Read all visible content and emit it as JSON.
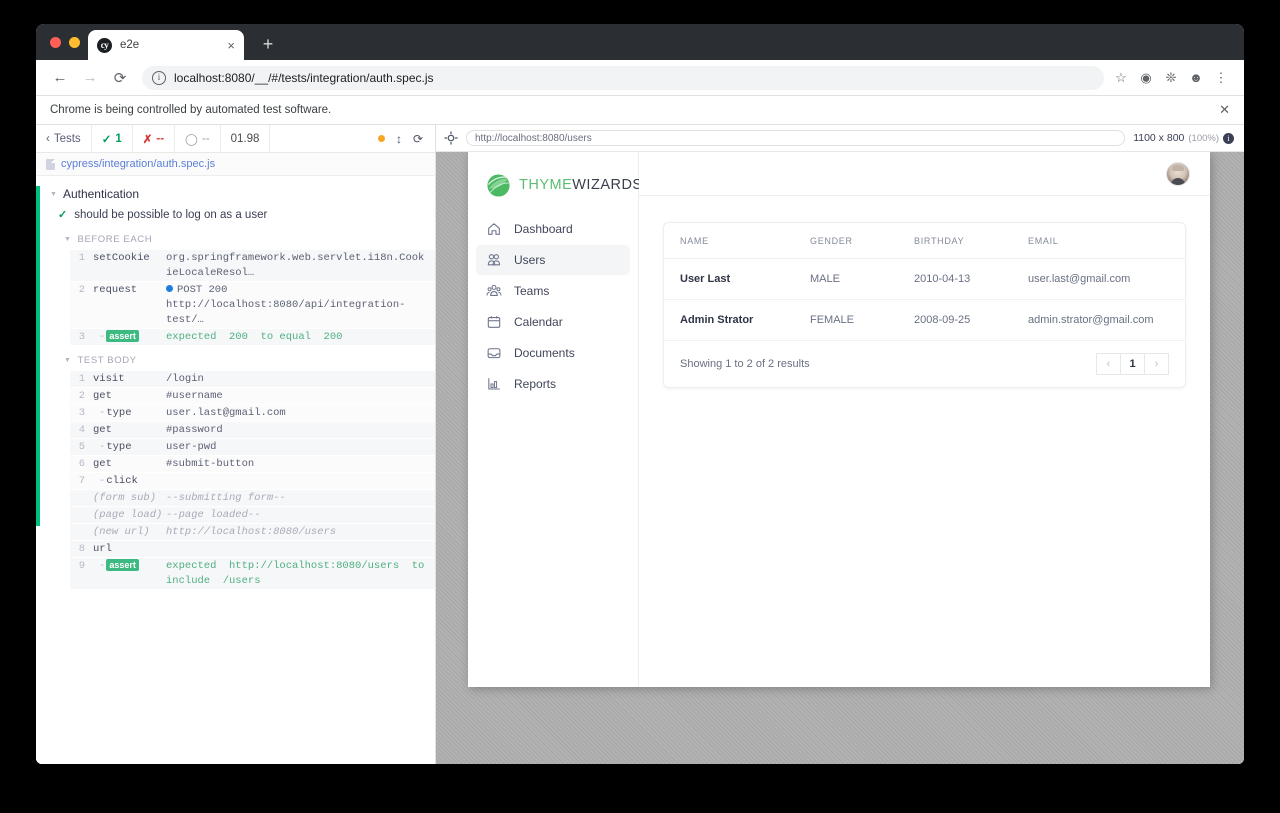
{
  "browser": {
    "tab": {
      "title": "e2e",
      "favicon": "cypress-logo-icon",
      "close_label": "×"
    },
    "new_tab_label": "+",
    "nav": {
      "back": "←",
      "forward": "→",
      "reload": "⟳"
    },
    "address": {
      "url": "localhost:8080/__/#/tests/integration/auth.spec.js",
      "info_icon": "i"
    },
    "toolbar_icons": [
      "bookmark-star-icon",
      "extension-cypress-icon",
      "extensions-puzzle-icon",
      "profile-icon",
      "chrome-menu-icon"
    ],
    "infobar": {
      "message": "Chrome is being controlled by automated test software.",
      "close": "✕"
    }
  },
  "runner": {
    "header": {
      "back_label": "Tests",
      "passed": "1",
      "failed": "--",
      "pending": "--",
      "duration": "01.98",
      "icons": [
        "record-dot-icon",
        "resize-handle-icon",
        "restart-icon",
        "selector-playground-icon"
      ]
    },
    "spec_path": "cypress/integration/auth.spec.js",
    "suite": "Authentication",
    "test": "should be possible to log on as a user",
    "hooks": [
      {
        "label": "BEFORE EACH",
        "commands": [
          {
            "num": "1",
            "name": "setCookie",
            "message": "org.springframework.web.servlet.i18n.CookieLocaleResol…",
            "type": "normal"
          },
          {
            "num": "2",
            "name": "request",
            "message": "POST 200 http://localhost:8080/api/integration-test/…",
            "type": "request"
          },
          {
            "num": "3",
            "name": "assert",
            "message": "expected  200  to equal  200",
            "type": "assert"
          }
        ]
      },
      {
        "label": "TEST BODY",
        "commands": [
          {
            "num": "1",
            "name": "visit",
            "message": "/login",
            "type": "normal"
          },
          {
            "num": "2",
            "name": "get",
            "message": "#username",
            "type": "normal"
          },
          {
            "num": "3",
            "name": "type",
            "message": "user.last@gmail.com",
            "type": "child"
          },
          {
            "num": "4",
            "name": "get",
            "message": "#password",
            "type": "normal"
          },
          {
            "num": "5",
            "name": "type",
            "message": "user-pwd",
            "type": "child"
          },
          {
            "num": "6",
            "name": "get",
            "message": "#submit-button",
            "type": "normal"
          },
          {
            "num": "7",
            "name": "click",
            "message": "",
            "type": "child"
          },
          {
            "num": "",
            "name": "(form sub)",
            "message": "--submitting form--",
            "type": "event"
          },
          {
            "num": "",
            "name": "(page load)",
            "message": "--page loaded--",
            "type": "event"
          },
          {
            "num": "",
            "name": "(new url)",
            "message": "http://localhost:8080/users",
            "type": "event"
          },
          {
            "num": "8",
            "name": "url",
            "message": "",
            "type": "normal"
          },
          {
            "num": "9",
            "name": "assert",
            "message": "expected  http://localhost:8080/users  to include  /users",
            "type": "assert"
          }
        ]
      }
    ]
  },
  "preview": {
    "url": "http://localhost:8080/users",
    "viewport": "1100 x 800",
    "scale": "(100%)",
    "info_icon": "i"
  },
  "app": {
    "brand": {
      "part1": "THYME",
      "part2": "WIZARDS",
      "mark": "leaf-globe-logo-icon"
    },
    "nav": [
      {
        "label": "Dashboard",
        "icon": "home-icon",
        "active": false
      },
      {
        "label": "Users",
        "icon": "users-icon",
        "active": true
      },
      {
        "label": "Teams",
        "icon": "teams-icon",
        "active": false
      },
      {
        "label": "Calendar",
        "icon": "calendar-icon",
        "active": false
      },
      {
        "label": "Documents",
        "icon": "documents-inbox-icon",
        "active": false
      },
      {
        "label": "Reports",
        "icon": "bar-chart-icon",
        "active": false
      }
    ],
    "avatar": "user-avatar",
    "table": {
      "columns": [
        "NAME",
        "GENDER",
        "BIRTHDAY",
        "EMAIL"
      ],
      "rows": [
        {
          "name": "User Last",
          "gender": "MALE",
          "birthday": "2010-04-13",
          "email": "user.last@gmail.com"
        },
        {
          "name": "Admin Strator",
          "gender": "FEMALE",
          "birthday": "2008-09-25",
          "email": "admin.strator@gmail.com"
        }
      ],
      "footer": "Showing 1 to 2 of 2 results",
      "pager": {
        "prev": "‹",
        "current": "1",
        "next": "›"
      }
    }
  },
  "colors": {
    "accent_green": "#00c07f",
    "brand_green": "#5bbd72",
    "assert_green": "#3dba82",
    "fail_red": "#d63b3b",
    "request_blue": "#1f7ce0"
  }
}
